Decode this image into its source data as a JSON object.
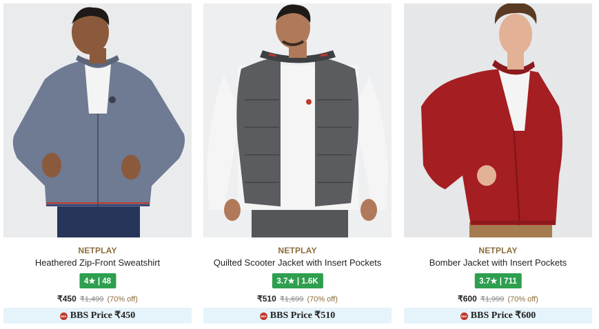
{
  "products": [
    {
      "image_alt": "heathered grey zip-front sweatshirt",
      "brand": "NETPLAY",
      "name": "Heathered Zip-Front Sweatshirt",
      "rating_label": "4★ | 48",
      "price": "₹450",
      "mrp": "₹1,499",
      "discount": "(70% off)",
      "bbs_label": "BBS Price ₹450"
    },
    {
      "image_alt": "grey quilted scooter jacket",
      "brand": "NETPLAY",
      "name": "Quilted Scooter Jacket with Insert Pockets",
      "rating_label": "3.7★ | 1.6K",
      "price": "₹510",
      "mrp": "₹1,699",
      "discount": "(70% off)",
      "bbs_label": "BBS Price ₹510"
    },
    {
      "image_alt": "red bomber jacket",
      "brand": "NETPLAY",
      "name": "Bomber Jacket with Insert Pockets",
      "rating_label": "3.7★ | 711",
      "price": "₹600",
      "mrp": "₹1,999",
      "discount": "(70% off)",
      "bbs_label": "BBS Price ₹600"
    }
  ],
  "bbs_icon_text": "BBS",
  "colors": {
    "rating_badge": "#2e9e4f",
    "brand_text": "#8a6d3b",
    "bbs_background": "#e5f4fb",
    "bbs_icon": "#c0392b"
  }
}
